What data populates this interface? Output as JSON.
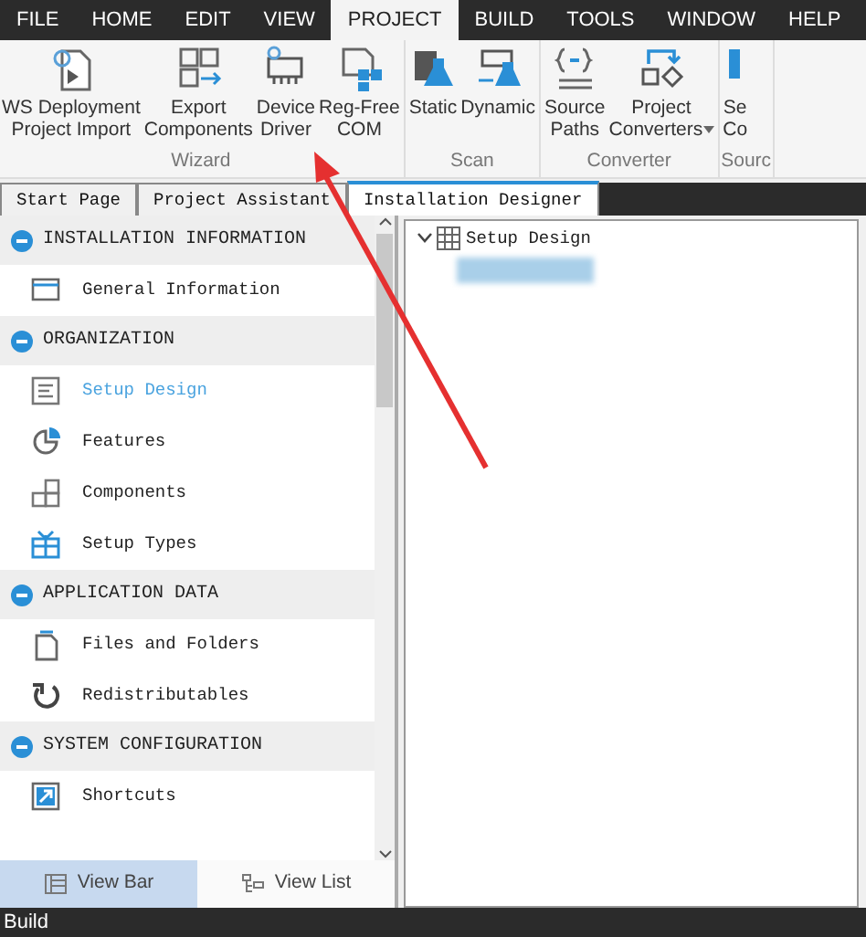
{
  "menu": [
    {
      "label": "FILE",
      "selected": false
    },
    {
      "label": "HOME",
      "selected": false
    },
    {
      "label": "EDIT",
      "selected": false
    },
    {
      "label": "VIEW",
      "selected": false
    },
    {
      "label": "PROJECT",
      "selected": true
    },
    {
      "label": "BUILD",
      "selected": false
    },
    {
      "label": "TOOLS",
      "selected": false
    },
    {
      "label": "WINDOW",
      "selected": false
    },
    {
      "label": "HELP",
      "selected": false
    }
  ],
  "ribbon": {
    "groups": [
      {
        "label": "Wizard",
        "buttons": [
          {
            "kind": "deployment",
            "label": "WS Deployment\nProject Import"
          },
          {
            "kind": "export",
            "label": "Export\nComponents"
          },
          {
            "kind": "driver",
            "label": "Device\nDriver"
          },
          {
            "kind": "com",
            "label": "Reg-Free\nCOM"
          }
        ]
      },
      {
        "label": "Scan",
        "buttons": [
          {
            "kind": "static",
            "label": "Static"
          },
          {
            "kind": "dynamic",
            "label": "Dynamic"
          }
        ]
      },
      {
        "label": "Converter",
        "buttons": [
          {
            "kind": "paths",
            "label": "Source\nPaths"
          },
          {
            "kind": "converters",
            "label": "Project\nConverters",
            "dropdown": true
          }
        ]
      },
      {
        "label": "Sourc",
        "buttons": [
          {
            "kind": "partial",
            "label": "Se\nCo"
          }
        ]
      }
    ]
  },
  "doc_tabs": [
    {
      "label": "Start Page",
      "selected": false
    },
    {
      "label": "Project Assistant",
      "selected": false
    },
    {
      "label": "Installation Designer",
      "selected": true
    }
  ],
  "sidebar": {
    "sections": [
      {
        "title": "INSTALLATION INFORMATION",
        "expanded": true,
        "items": [
          {
            "kind": "window",
            "label": "General Information",
            "selected": false
          }
        ]
      },
      {
        "title": "ORGANIZATION",
        "expanded": true,
        "items": [
          {
            "kind": "design",
            "label": "Setup Design",
            "selected": true
          },
          {
            "kind": "features",
            "label": "Features",
            "selected": false
          },
          {
            "kind": "components",
            "label": "Components",
            "selected": false
          },
          {
            "kind": "types",
            "label": "Setup Types",
            "selected": false
          }
        ]
      },
      {
        "title": "APPLICATION DATA",
        "expanded": true,
        "items": [
          {
            "kind": "files",
            "label": "Files and Folders",
            "selected": false
          },
          {
            "kind": "redist",
            "label": "Redistributables",
            "selected": false
          }
        ]
      },
      {
        "title": "SYSTEM CONFIGURATION",
        "expanded": true,
        "items": [
          {
            "kind": "shortcuts",
            "label": "Shortcuts",
            "selected": false
          }
        ]
      }
    ],
    "view_buttons": [
      {
        "kind": "bar",
        "label": "View Bar",
        "selected": true
      },
      {
        "kind": "list",
        "label": "View List",
        "selected": false
      }
    ]
  },
  "tree": {
    "label": "Setup Design",
    "expanded": true
  },
  "status_bar": {
    "text": "Build"
  }
}
